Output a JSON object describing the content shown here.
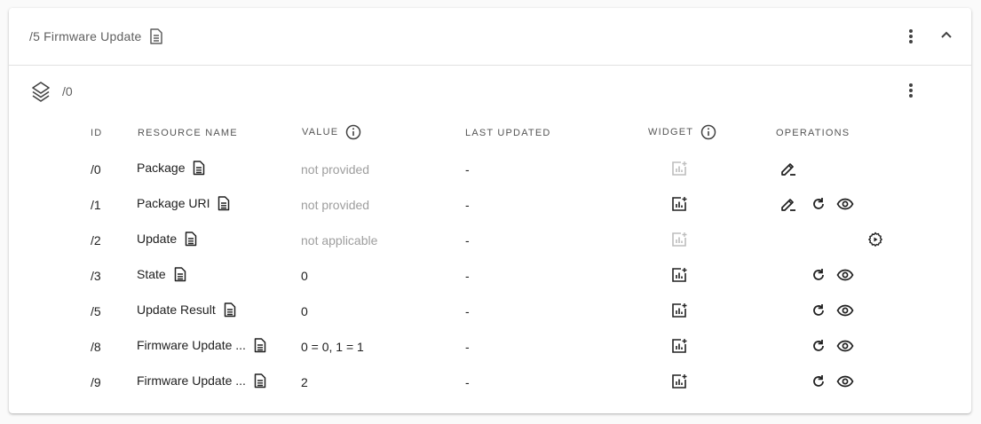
{
  "header": {
    "title": "/5 Firmware Update"
  },
  "instance": {
    "label": "/0"
  },
  "columns": {
    "id": "ID",
    "resource_name": "RESOURCE NAME",
    "value": "VALUE",
    "last_updated": "LAST UPDATED",
    "widget": "WIDGET",
    "operations": "OPERATIONS"
  },
  "rows": [
    {
      "id": "/0",
      "name": "Package",
      "value": "not provided",
      "value_muted": true,
      "last_updated": "-",
      "widget_enabled": false,
      "ops": [
        "write"
      ]
    },
    {
      "id": "/1",
      "name": "Package URI",
      "value": "not provided",
      "value_muted": true,
      "last_updated": "-",
      "widget_enabled": true,
      "ops": [
        "write",
        "read",
        "observe"
      ]
    },
    {
      "id": "/2",
      "name": "Update",
      "value": "not applicable",
      "value_muted": true,
      "last_updated": "-",
      "widget_enabled": false,
      "ops": [
        "execute"
      ]
    },
    {
      "id": "/3",
      "name": "State",
      "value": "0",
      "value_muted": false,
      "last_updated": "-",
      "widget_enabled": true,
      "ops": [
        "read",
        "observe"
      ]
    },
    {
      "id": "/5",
      "name": "Update Result",
      "value": "0",
      "value_muted": false,
      "last_updated": "-",
      "widget_enabled": true,
      "ops": [
        "read",
        "observe"
      ]
    },
    {
      "id": "/8",
      "name": "Firmware Update ...",
      "value": "0 = 0, 1 = 1",
      "value_muted": false,
      "last_updated": "-",
      "widget_enabled": true,
      "ops": [
        "read",
        "observe"
      ]
    },
    {
      "id": "/9",
      "name": "Firmware Update ...",
      "value": "2",
      "value_muted": false,
      "last_updated": "-",
      "widget_enabled": true,
      "ops": [
        "read",
        "observe"
      ]
    }
  ],
  "colors": {
    "icon": "#212121",
    "icon_disabled": "#bdbdbd",
    "muted_text": "#9e9e9e"
  },
  "icons": {
    "doc": "description-icon",
    "layers": "layers-icon",
    "more": "more-vert-icon",
    "collapse": "chevron-up-icon",
    "info": "info-icon",
    "widget": "add-chart-icon",
    "write": "edit-icon",
    "read": "refresh-icon",
    "observe": "eye-icon",
    "execute": "settings-play-icon"
  }
}
